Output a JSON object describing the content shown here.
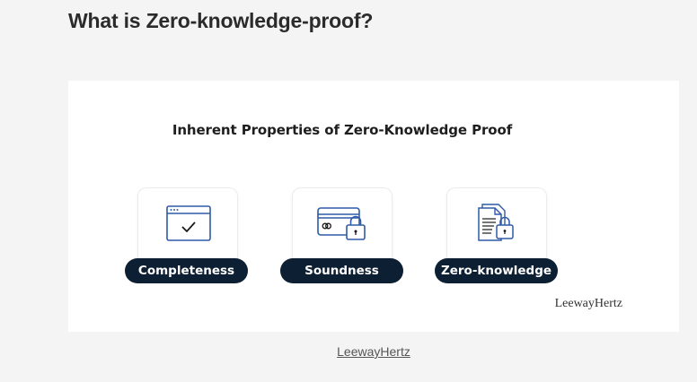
{
  "page": {
    "heading": "What is Zero-knowledge-proof?"
  },
  "figure": {
    "title": "Inherent Properties of Zero-Knowledge Proof",
    "properties": [
      {
        "label": "Completeness",
        "icon": "browser-checkmark-icon"
      },
      {
        "label": "Soundness",
        "icon": "card-lock-icon"
      },
      {
        "label": "Zero-knowledge",
        "icon": "document-lock-icon"
      }
    ],
    "brand": "LeewayHertz",
    "colors": {
      "pill": "#0c1f33",
      "icon_stroke": "#2f5aa8"
    }
  },
  "caption": {
    "link_text": "LeewayHertz"
  }
}
